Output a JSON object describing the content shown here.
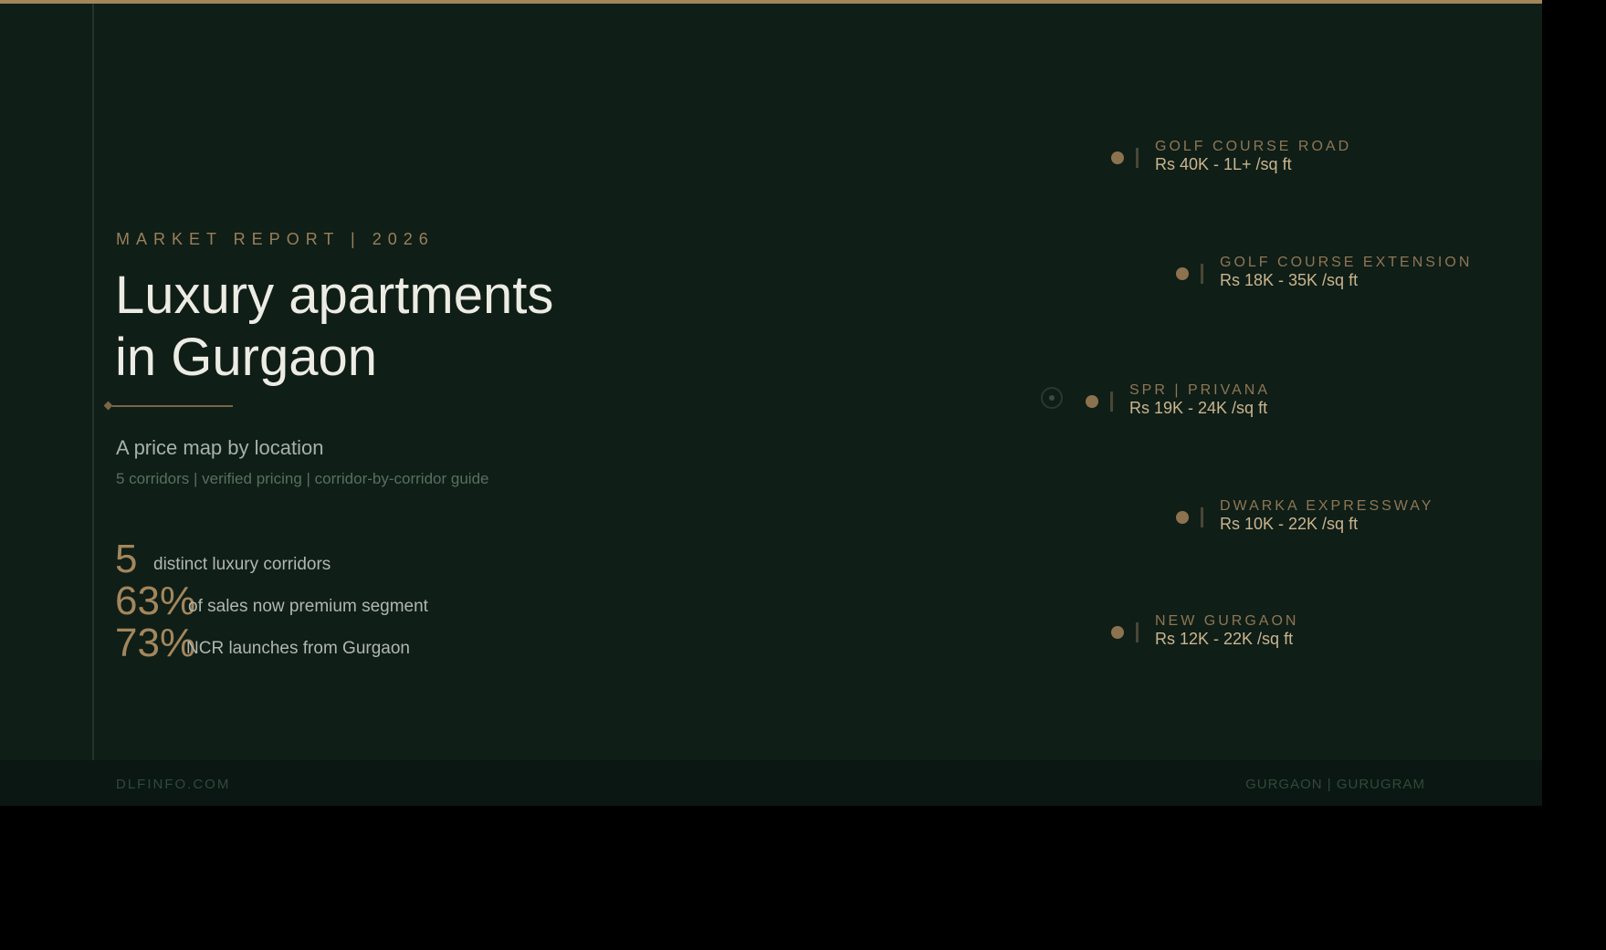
{
  "header": {
    "eyebrow": "MARKET REPORT | 2026",
    "title_line1": "Luxury apartments",
    "title_line2": "in Gurgaon",
    "subtitle": "A price map by location",
    "tagline": "5 corridors | verified pricing | corridor-by-corridor guide"
  },
  "stats": [
    {
      "value": "5",
      "label": "distinct luxury corridors"
    },
    {
      "value": "63%",
      "label": "of sales now premium segment"
    },
    {
      "value": "73%",
      "label": "NCR launches from Gurgaon"
    }
  ],
  "corridors": [
    {
      "name": "GOLF COURSE ROAD",
      "price": "Rs 40K - 1L+ /sq ft"
    },
    {
      "name": "GOLF COURSE EXTENSION",
      "price": "Rs 18K - 35K /sq ft"
    },
    {
      "name": "SPR | PRIVANA",
      "price": "Rs 19K - 24K /sq ft"
    },
    {
      "name": "DWARKA EXPRESSWAY",
      "price": "Rs 10K - 22K /sq ft"
    },
    {
      "name": "NEW GURGAON",
      "price": "Rs 12K - 22K /sq ft"
    }
  ],
  "footer": {
    "left": "DLFINFO.COM",
    "right": "GURGAON | GURUGRAM"
  },
  "colors": {
    "background": "#0f1e17",
    "accent_gold": "#a3865c",
    "title_text": "#ecebe4",
    "outer_background": "#000000"
  }
}
